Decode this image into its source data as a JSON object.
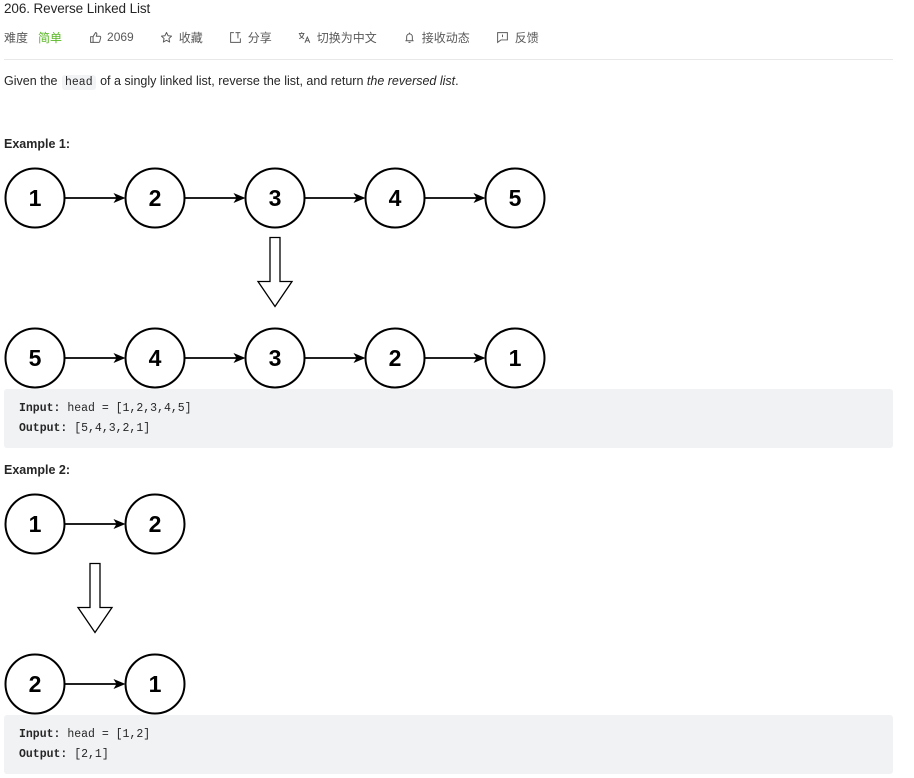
{
  "problem": {
    "title": "206. Reverse Linked List",
    "toolbar": {
      "difficulty_label": "难度",
      "difficulty_value": "简单",
      "difficulty_color": "#5ab726",
      "likes_count": "2069",
      "favorite_label": "收藏",
      "share_label": "分享",
      "translate_label": "切换为中文",
      "subscribe_label": "接收动态",
      "feedback_label": "反馈"
    },
    "description": {
      "prefix": "Given the",
      "code_term": "head",
      "middle": "of a singly linked list, reverse the list, and return",
      "emphasis": "the reversed list",
      "suffix": "."
    }
  },
  "examples": [
    {
      "title": "Example 1:",
      "before": [
        1,
        2,
        3,
        4,
        5
      ],
      "after": [
        5,
        4,
        3,
        2,
        1
      ],
      "input_label": "Input:",
      "input_value": "head = [1,2,3,4,5]",
      "output_label": "Output:",
      "output_value": "[5,4,3,2,1]"
    },
    {
      "title": "Example 2:",
      "before": [
        1,
        2
      ],
      "after": [
        2,
        1
      ],
      "input_label": "Input:",
      "input_value": "head = [1,2]",
      "output_label": "Output:",
      "output_value": "[2,1]"
    }
  ]
}
